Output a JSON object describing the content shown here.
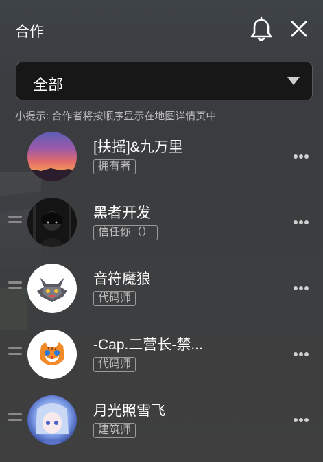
{
  "header": {
    "title": "合作",
    "bell_icon": "bell-icon",
    "close_icon": "close-icon"
  },
  "filter": {
    "selected": "全部"
  },
  "hint": "小提示: 合作者将按顺序显示在地图详情页中",
  "members": [
    {
      "name": "[扶摇]&九万里",
      "role": "拥有者"
    },
    {
      "name": "黑者开发",
      "role": "信任你（）"
    },
    {
      "name": "音符魔狼",
      "role": "代码师"
    },
    {
      "name": "-Cap.二营长-禁...",
      "role": "代码师"
    },
    {
      "name": "月光照雪飞",
      "role": "建筑师"
    }
  ],
  "colors": {
    "panel_bg": "#3f3f3f",
    "select_bg": "#171717",
    "text": "#ffffff",
    "muted": "#b9b9b9"
  }
}
